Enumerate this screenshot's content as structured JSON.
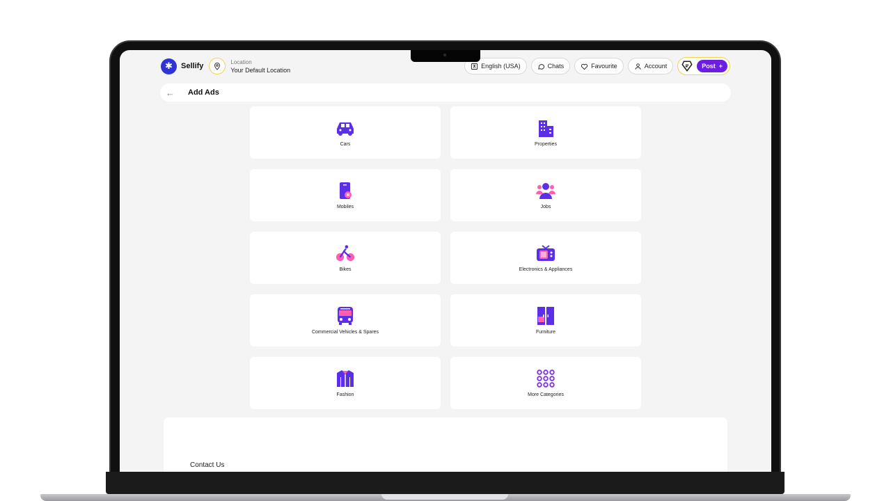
{
  "app": {
    "brand": "Sellify"
  },
  "location": {
    "label": "Location",
    "value": "Your Default Location"
  },
  "nav": {
    "language": "English (USA)",
    "chats": "Chats",
    "favourite": "Favourite",
    "account": "Account",
    "post": "Post",
    "post_plus": "+"
  },
  "page": {
    "back": "←",
    "title": "Add Ads"
  },
  "categories": [
    {
      "label": "Cars",
      "icon": "car-icon"
    },
    {
      "label": "Properties",
      "icon": "building-icon"
    },
    {
      "label": "Mobiles",
      "icon": "mobile-icon"
    },
    {
      "label": "Jobs",
      "icon": "jobs-icon"
    },
    {
      "label": "Bikes",
      "icon": "bike-icon"
    },
    {
      "label": "Electronics & Appliances",
      "icon": "tv-icon"
    },
    {
      "label": "Commercial Vehicles & Spares",
      "icon": "bus-icon"
    },
    {
      "label": "Furniture",
      "icon": "wardrobe-icon"
    },
    {
      "label": "Fashion",
      "icon": "jacket-icon"
    },
    {
      "label": "More Categories",
      "icon": "grid-dots-icon"
    }
  ],
  "footer": {
    "contact": "Contact Us"
  },
  "colors": {
    "accent": "#6b1de0",
    "icon_primary": "#5b2ee8",
    "icon_secondary": "#ff5fb0",
    "logo": "#2f34d6"
  }
}
